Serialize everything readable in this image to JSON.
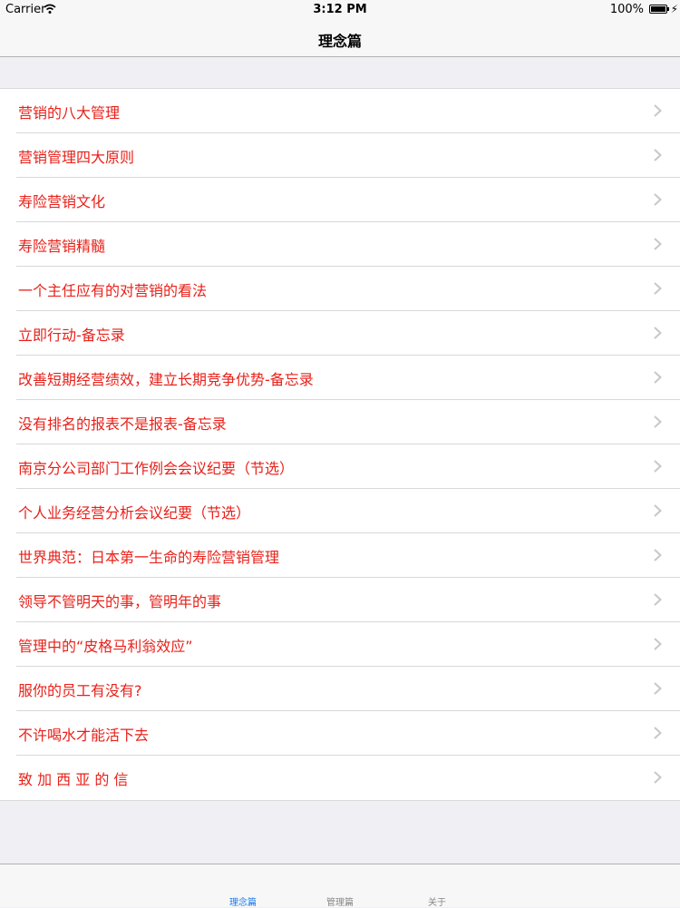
{
  "status_bar": {
    "carrier": "Carrier",
    "time": "3:12 PM",
    "battery": "100%"
  },
  "nav": {
    "title": "理念篇"
  },
  "list": {
    "items": [
      "营销的八大管理",
      "营销管理四大原则",
      "寿险营销文化",
      "寿险营销精髓",
      "一个主任应有的对营销的看法",
      "立即行动-备忘录",
      "改善短期经营绩效，建立长期竞争优势-备忘录",
      "没有排名的报表不是报表-备忘录",
      "南京分公司部门工作例会会议纪要（节选）",
      "个人业务经营分析会议纪要（节选）",
      "世界典范：日本第一生命的寿险营销管理",
      "领导不管明天的事，管明年的事",
      "管理中的“皮格马利翁效应”",
      "服你的员工有没有?",
      "不许喝水才能活下去",
      "致 加 西 亚 的 信"
    ]
  },
  "tabbar": {
    "tabs": [
      "理念篇",
      "管理篇",
      "关于"
    ],
    "active_color": "#1a7cf0"
  },
  "colors": {
    "row_text": "#e8211a",
    "background": "#efeff4"
  }
}
